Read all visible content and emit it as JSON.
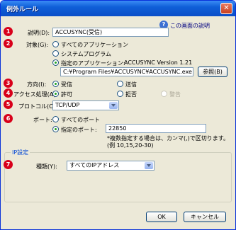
{
  "window": {
    "title": "例外ルール",
    "close": "✕"
  },
  "help_link": "この画面の説明",
  "markers": [
    "1",
    "2",
    "3",
    "4",
    "5",
    "6",
    "7"
  ],
  "description": {
    "label": "説明(D):",
    "value": "ACCUSYNC(受信)"
  },
  "target": {
    "label": "対象(G):",
    "options": [
      "すべてのアプリケーション",
      "システムプログラム",
      "指定のアプリケーション:"
    ],
    "selected": 2,
    "app_name": "ACCUSYNC Version 1.21",
    "path": "C:¥Program Files¥ACCUSYNC¥ACCUSYNC.exe",
    "browse_label": "参照(B)"
  },
  "direction": {
    "label": "方向(I):",
    "options": [
      "受信",
      "送信"
    ],
    "selected": 0
  },
  "access": {
    "label": "アクセス処理(A):",
    "options": [
      "許可",
      "拒否",
      "警告"
    ],
    "selected": 0
  },
  "protocol": {
    "label": "プロトコル(C):",
    "value": "TCP/UDP"
  },
  "port": {
    "label": "ポート:",
    "options": [
      "すべてのポート",
      "指定のポート:"
    ],
    "selected": 1,
    "value": "22850",
    "note1": "*複数指定する場合は、カンマ(,)で区切ります。",
    "note2": "(例 10,15,20-30)"
  },
  "ip": {
    "group_title": "IP設定",
    "type_label": "種類(Y):",
    "type_value": "すべてのIPアドレス"
  },
  "buttons": {
    "ok": "OK",
    "cancel": "キャンセル"
  }
}
